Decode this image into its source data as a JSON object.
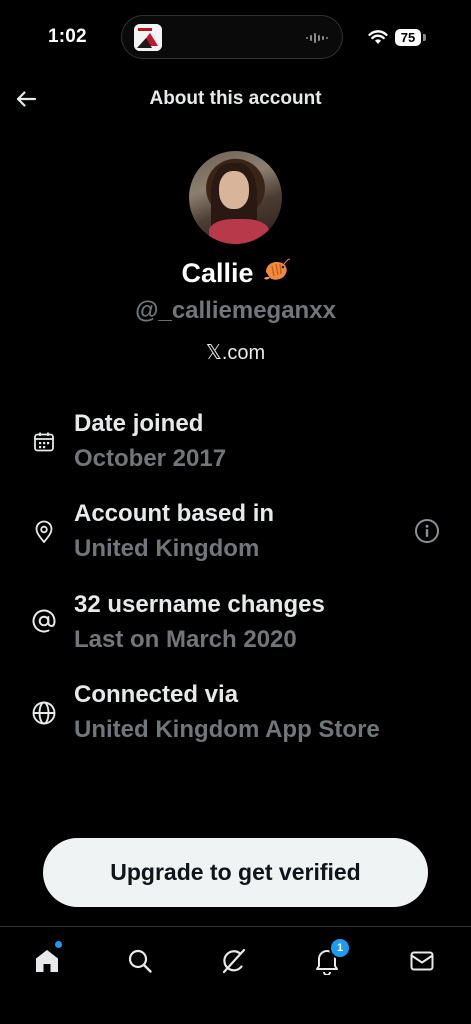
{
  "status_bar": {
    "time": "1:02",
    "battery": "75"
  },
  "header": {
    "title": "About this account"
  },
  "profile": {
    "display_name": "Callie",
    "name_emoji": "🦐",
    "handle": "@_calliemeganxx",
    "site": "𝕏.com"
  },
  "info": [
    {
      "icon": "calendar-icon",
      "title": "Date joined",
      "subtitle": "October 2017"
    },
    {
      "icon": "location-pin-icon",
      "title": "Account based in",
      "subtitle": "United Kingdom",
      "has_info_icon": true
    },
    {
      "icon": "at-sign-icon",
      "title": "32 username changes",
      "subtitle": "Last on March 2020"
    },
    {
      "icon": "globe-icon",
      "title": "Connected via",
      "subtitle": "United Kingdom App Store"
    }
  ],
  "upgrade": {
    "label": "Upgrade to get verified"
  },
  "bottom_nav": {
    "items": [
      {
        "icon": "home-icon"
      },
      {
        "icon": "search-icon"
      },
      {
        "icon": "grok-icon"
      },
      {
        "icon": "bell-icon",
        "badge": "1"
      },
      {
        "icon": "mail-icon"
      }
    ]
  },
  "colors": {
    "background": "#000000",
    "primary_text": "#e7e9ea",
    "secondary_text": "#71767b",
    "accent": "#1d9bf0",
    "button_bg": "#eff3f4"
  }
}
